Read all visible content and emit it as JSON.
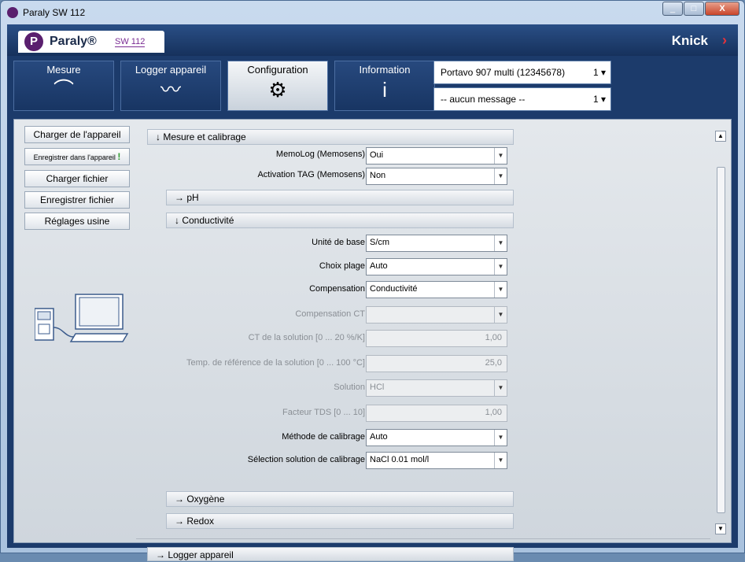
{
  "window": {
    "title": "Paraly SW 112",
    "controls": [
      "_",
      "□",
      "X"
    ]
  },
  "header": {
    "logo_mark": "P",
    "logo_name": "Paraly®",
    "logo_sw": "SW 112",
    "brand": "Knick",
    "brand_chevron": "›"
  },
  "tabs": [
    {
      "label": "Mesure",
      "icon": "gauge-icon",
      "glyph": "⌒"
    },
    {
      "label": "Logger appareil",
      "icon": "trend-line-icon",
      "glyph": "〰"
    },
    {
      "label": "Configuration",
      "icon": "gear-icon",
      "glyph": "⚙"
    },
    {
      "label": "Information",
      "icon": "info-icon",
      "glyph": "i"
    }
  ],
  "device_select": {
    "value": "Portavo 907 multi (12345678)",
    "number": "1 ▾"
  },
  "message_select": {
    "value": "-- aucun message --",
    "number": "1 ▾"
  },
  "sidebar": {
    "load_device": "Charger de l'appareil",
    "save_device": "Enregistrer dans l'appareil",
    "save_device_mark": "!",
    "load_file": "Charger fichier",
    "save_file": "Enregistrer fichier",
    "factory": "Réglages usine"
  },
  "sections": {
    "mesure": "↓  Mesure et calibrage",
    "ph": "→  pH",
    "conductivite": "↓  Conductivité",
    "oxygene": "→  Oxygène",
    "redox": "→  Redox",
    "logger": "→  Logger appareil"
  },
  "fields": {
    "memolog": {
      "label": "MemoLog (Memosens)",
      "value": "Oui"
    },
    "activation_tag": {
      "label": "Activation TAG (Memosens)",
      "value": "Non"
    },
    "unite_base": {
      "label": "Unité de base",
      "value": "S/cm"
    },
    "choix_plage": {
      "label": "Choix plage",
      "value": "Auto"
    },
    "compensation": {
      "label": "Compensation",
      "value": "Conductivité"
    },
    "compensation_ct": {
      "label": "Compensation CT",
      "value": ""
    },
    "ct_solution": {
      "label": "CT de la solution [0 ... 20 %/K]",
      "value": "1,00"
    },
    "temp_ref": {
      "label": "Temp. de référence de la solution [0 ... 100 °C]",
      "value": "25,0"
    },
    "solution": {
      "label": "Solution",
      "value": "HCl"
    },
    "facteur_tds": {
      "label": "Facteur TDS [0 ... 10]",
      "value": "1,00"
    },
    "methode_calib": {
      "label": "Méthode de calibrage",
      "value": "Auto"
    },
    "selection_solution": {
      "label": "Sélection solution de calibrage",
      "value": "NaCl 0.01 mol/l"
    }
  },
  "scroll": {
    "up": "▲",
    "down": "▼"
  }
}
